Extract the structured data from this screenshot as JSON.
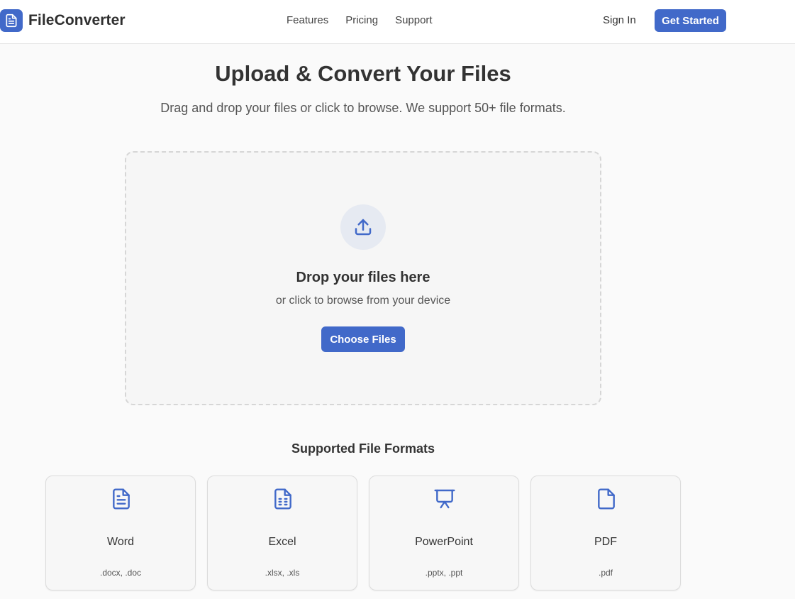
{
  "brand": {
    "name": "FileConverter",
    "accent": "#4169c9"
  },
  "nav": {
    "items": [
      "Features",
      "Pricing",
      "Support"
    ]
  },
  "header": {
    "sign_in": "Sign In",
    "get_started": "Get Started"
  },
  "hero": {
    "title": "Upload & Convert Your Files",
    "subtitle": "Drag and drop your files or click to browse. We support 50+ file formats."
  },
  "dropzone": {
    "icon": "upload-icon",
    "title": "Drop your files here",
    "subtitle": "or click to browse from your device",
    "button": "Choose Files"
  },
  "formats": {
    "title": "Supported File Formats",
    "cards": [
      {
        "name": "Word",
        "ext": ".docx, .doc",
        "icon": "document-lines-icon"
      },
      {
        "name": "Excel",
        "ext": ".xlsx, .xls",
        "icon": "spreadsheet-icon"
      },
      {
        "name": "PowerPoint",
        "ext": ".pptx, .ppt",
        "icon": "presentation-icon"
      },
      {
        "name": "PDF",
        "ext": ".pdf",
        "icon": "file-icon"
      }
    ]
  }
}
